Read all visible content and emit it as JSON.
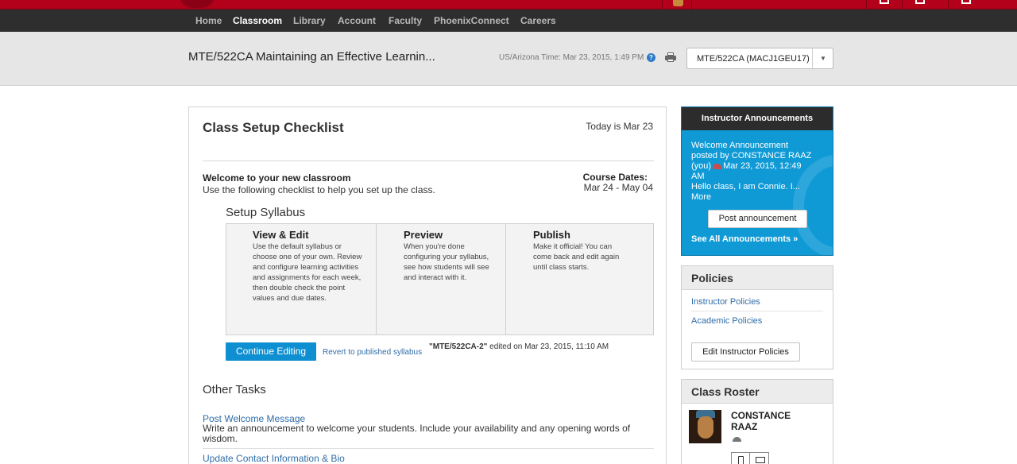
{
  "nav": {
    "items": [
      {
        "label": "Home",
        "active": false
      },
      {
        "label": "Classroom",
        "active": true
      },
      {
        "label": "Library",
        "active": false
      },
      {
        "label": "Account",
        "active": false
      },
      {
        "label": "Faculty",
        "active": false
      },
      {
        "label": "PhoenixConnect",
        "active": false
      },
      {
        "label": "Careers",
        "active": false
      }
    ]
  },
  "header": {
    "course_title": "MTE/522CA Maintaining an Effective Learnin...",
    "timezone": "US/Arizona Time: Mar 23, 2015, 1:49 PM",
    "help_icon": "question-circle-icon",
    "print_icon": "printer-icon",
    "course_select": "MTE/522CA (MACJ1GEU17)"
  },
  "checklist": {
    "title": "Class Setup Checklist",
    "today": "Today is Mar 23",
    "welcome_heading": "Welcome to your new classroom",
    "welcome_sub": "Use the following checklist to help you set up the class.",
    "course_dates_label": "Course Dates:",
    "course_dates_value": "Mar 24 - May 04",
    "syllabus_heading": "Setup Syllabus",
    "steps": [
      {
        "title": "View & Edit",
        "lines": [
          "Use the default syllabus or",
          "choose one of your own. Review",
          "and configure learning activities",
          "and assignments for each week,",
          "then double check the point",
          "values and due dates."
        ]
      },
      {
        "title": "Preview",
        "lines": [
          "When you're done",
          "configuring your syllabus,",
          "see how students will see",
          "and interact with it."
        ]
      },
      {
        "title": "Publish",
        "lines": [
          "Make it official! You can",
          "come back and edit again",
          "until class starts."
        ]
      }
    ],
    "continue_button": "Continue Editing",
    "revert_link": "Revert to published syllabus",
    "edited_course": "\"MTE/522CA-2\"",
    "edited_text": " edited on Mar 23, 2015, 11:10 AM",
    "other_heading": "Other Tasks",
    "tasks": [
      {
        "link": "Post Welcome Message",
        "desc": "Write an announcement to welcome your students. Include your availability and any opening words of wisdom."
      },
      {
        "link": "Update Contact Information & Bio",
        "desc": ""
      }
    ]
  },
  "announcements": {
    "heading": "Instructor Announcements",
    "title": "Welcome Announcement",
    "posted_by": "posted by CONSTANCE RAAZ",
    "you": "(you)",
    "date_part1": "Mar 23, 2015, 12:49",
    "date_part2": "AM",
    "preview": "Hello class, I am Connie. I...",
    "more": "More",
    "post_button": "Post announcement",
    "see_all": "See All Announcements »"
  },
  "policies": {
    "heading": "Policies",
    "links": [
      "Instructor Policies",
      "Academic Policies"
    ],
    "edit_button": "Edit Instructor Policies"
  },
  "roster": {
    "heading": "Class Roster",
    "name_line1": "CONSTANCE",
    "name_line2": "RAAZ"
  },
  "colors": {
    "brand_red": "#b3001b",
    "nav_bg": "#2e2e2e",
    "accent_blue": "#0e8fd1",
    "announcement_bg": "#0f9ad6",
    "link_blue": "#2f6da8"
  }
}
